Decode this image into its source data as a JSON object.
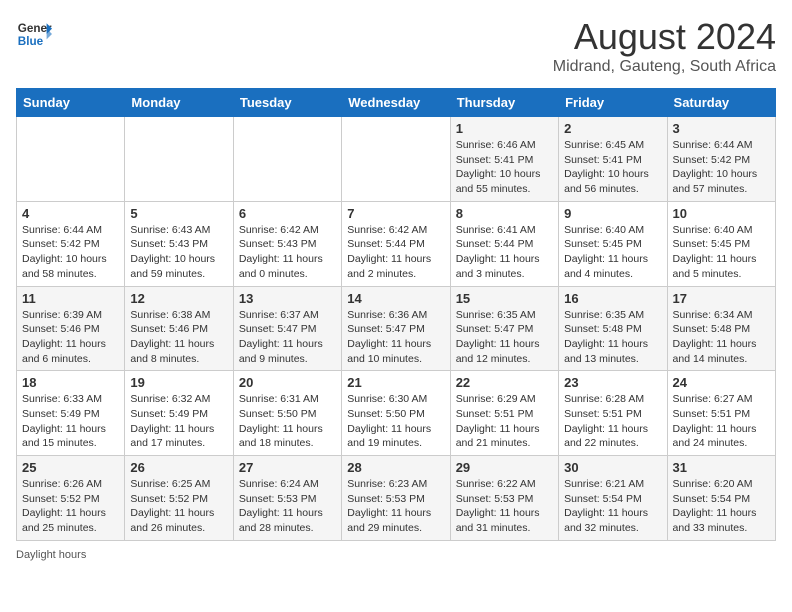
{
  "header": {
    "logo_line1": "General",
    "logo_line2": "Blue",
    "title": "August 2024",
    "subtitle": "Midrand, Gauteng, South Africa"
  },
  "weekdays": [
    "Sunday",
    "Monday",
    "Tuesday",
    "Wednesday",
    "Thursday",
    "Friday",
    "Saturday"
  ],
  "weeks": [
    [
      {
        "day": "",
        "info": ""
      },
      {
        "day": "",
        "info": ""
      },
      {
        "day": "",
        "info": ""
      },
      {
        "day": "",
        "info": ""
      },
      {
        "day": "1",
        "info": "Sunrise: 6:46 AM\nSunset: 5:41 PM\nDaylight: 10 hours and 55 minutes."
      },
      {
        "day": "2",
        "info": "Sunrise: 6:45 AM\nSunset: 5:41 PM\nDaylight: 10 hours and 56 minutes."
      },
      {
        "day": "3",
        "info": "Sunrise: 6:44 AM\nSunset: 5:42 PM\nDaylight: 10 hours and 57 minutes."
      }
    ],
    [
      {
        "day": "4",
        "info": "Sunrise: 6:44 AM\nSunset: 5:42 PM\nDaylight: 10 hours and 58 minutes."
      },
      {
        "day": "5",
        "info": "Sunrise: 6:43 AM\nSunset: 5:43 PM\nDaylight: 10 hours and 59 minutes."
      },
      {
        "day": "6",
        "info": "Sunrise: 6:42 AM\nSunset: 5:43 PM\nDaylight: 11 hours and 0 minutes."
      },
      {
        "day": "7",
        "info": "Sunrise: 6:42 AM\nSunset: 5:44 PM\nDaylight: 11 hours and 2 minutes."
      },
      {
        "day": "8",
        "info": "Sunrise: 6:41 AM\nSunset: 5:44 PM\nDaylight: 11 hours and 3 minutes."
      },
      {
        "day": "9",
        "info": "Sunrise: 6:40 AM\nSunset: 5:45 PM\nDaylight: 11 hours and 4 minutes."
      },
      {
        "day": "10",
        "info": "Sunrise: 6:40 AM\nSunset: 5:45 PM\nDaylight: 11 hours and 5 minutes."
      }
    ],
    [
      {
        "day": "11",
        "info": "Sunrise: 6:39 AM\nSunset: 5:46 PM\nDaylight: 11 hours and 6 minutes."
      },
      {
        "day": "12",
        "info": "Sunrise: 6:38 AM\nSunset: 5:46 PM\nDaylight: 11 hours and 8 minutes."
      },
      {
        "day": "13",
        "info": "Sunrise: 6:37 AM\nSunset: 5:47 PM\nDaylight: 11 hours and 9 minutes."
      },
      {
        "day": "14",
        "info": "Sunrise: 6:36 AM\nSunset: 5:47 PM\nDaylight: 11 hours and 10 minutes."
      },
      {
        "day": "15",
        "info": "Sunrise: 6:35 AM\nSunset: 5:47 PM\nDaylight: 11 hours and 12 minutes."
      },
      {
        "day": "16",
        "info": "Sunrise: 6:35 AM\nSunset: 5:48 PM\nDaylight: 11 hours and 13 minutes."
      },
      {
        "day": "17",
        "info": "Sunrise: 6:34 AM\nSunset: 5:48 PM\nDaylight: 11 hours and 14 minutes."
      }
    ],
    [
      {
        "day": "18",
        "info": "Sunrise: 6:33 AM\nSunset: 5:49 PM\nDaylight: 11 hours and 15 minutes."
      },
      {
        "day": "19",
        "info": "Sunrise: 6:32 AM\nSunset: 5:49 PM\nDaylight: 11 hours and 17 minutes."
      },
      {
        "day": "20",
        "info": "Sunrise: 6:31 AM\nSunset: 5:50 PM\nDaylight: 11 hours and 18 minutes."
      },
      {
        "day": "21",
        "info": "Sunrise: 6:30 AM\nSunset: 5:50 PM\nDaylight: 11 hours and 19 minutes."
      },
      {
        "day": "22",
        "info": "Sunrise: 6:29 AM\nSunset: 5:51 PM\nDaylight: 11 hours and 21 minutes."
      },
      {
        "day": "23",
        "info": "Sunrise: 6:28 AM\nSunset: 5:51 PM\nDaylight: 11 hours and 22 minutes."
      },
      {
        "day": "24",
        "info": "Sunrise: 6:27 AM\nSunset: 5:51 PM\nDaylight: 11 hours and 24 minutes."
      }
    ],
    [
      {
        "day": "25",
        "info": "Sunrise: 6:26 AM\nSunset: 5:52 PM\nDaylight: 11 hours and 25 minutes."
      },
      {
        "day": "26",
        "info": "Sunrise: 6:25 AM\nSunset: 5:52 PM\nDaylight: 11 hours and 26 minutes."
      },
      {
        "day": "27",
        "info": "Sunrise: 6:24 AM\nSunset: 5:53 PM\nDaylight: 11 hours and 28 minutes."
      },
      {
        "day": "28",
        "info": "Sunrise: 6:23 AM\nSunset: 5:53 PM\nDaylight: 11 hours and 29 minutes."
      },
      {
        "day": "29",
        "info": "Sunrise: 6:22 AM\nSunset: 5:53 PM\nDaylight: 11 hours and 31 minutes."
      },
      {
        "day": "30",
        "info": "Sunrise: 6:21 AM\nSunset: 5:54 PM\nDaylight: 11 hours and 32 minutes."
      },
      {
        "day": "31",
        "info": "Sunrise: 6:20 AM\nSunset: 5:54 PM\nDaylight: 11 hours and 33 minutes."
      }
    ]
  ],
  "footer": {
    "note": "Daylight hours"
  }
}
